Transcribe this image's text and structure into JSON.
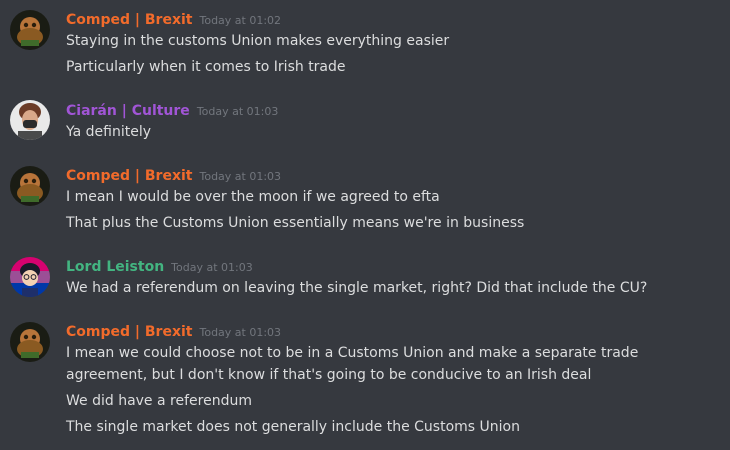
{
  "colors": {
    "background": "#36393f",
    "text": "#dcddde",
    "timestamp": "#72767d",
    "comped": "#f26b2b",
    "ciaran": "#a155d6",
    "lord": "#43b581"
  },
  "messages": [
    {
      "username": "Comped | Brexit",
      "timestamp": "Today at 01:02",
      "avatar": "comped-avatar",
      "lines": [
        "Staying in the customs Union makes everything easier",
        "Particularly when it comes to Irish trade"
      ]
    },
    {
      "username": "Ciarán | Culture",
      "timestamp": "Today at 01:03",
      "avatar": "ciaran-avatar",
      "lines": [
        "Ya definitely"
      ]
    },
    {
      "username": "Comped | Brexit",
      "timestamp": "Today at 01:03",
      "avatar": "comped-avatar",
      "lines": [
        "I mean I would be over the moon if we agreed to efta",
        "That plus the Customs Union essentially means we're in business"
      ]
    },
    {
      "username": "Lord Leiston",
      "timestamp": "Today at 01:03",
      "avatar": "lord-avatar",
      "lines": [
        "We had a referendum on leaving the single market, right? Did that include the CU?"
      ]
    },
    {
      "username": "Comped | Brexit",
      "timestamp": "Today at 01:03",
      "avatar": "comped-avatar",
      "lines": [
        "I mean we could choose not to be in a Customs Union and make a separate trade agreement, but I don't know if that's going to be conducive to an Irish deal",
        "We did have a referendum",
        "The single market does not generally include the Customs Union"
      ]
    }
  ]
}
